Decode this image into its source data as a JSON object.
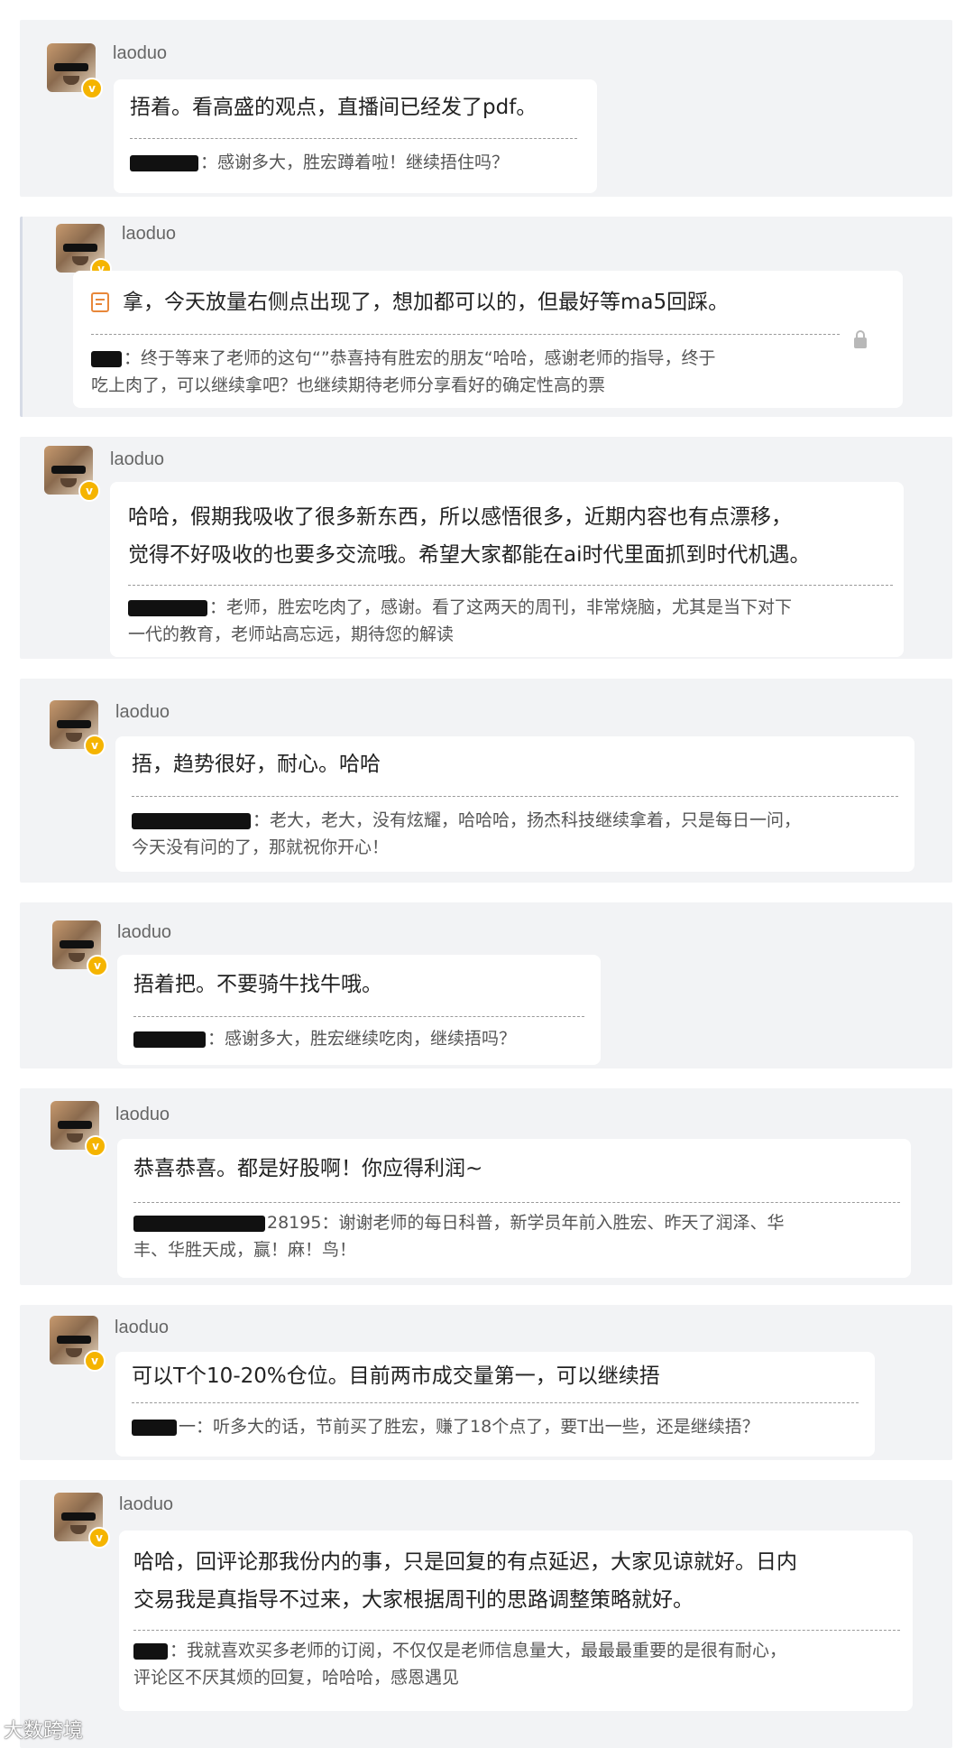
{
  "comments": [
    {
      "user": "laoduo",
      "message_lines": [
        "捂着。看高盛的观点，直播间已经发了pdf。"
      ],
      "reply_author_suffix": "",
      "reply_lines": [
        "：感谢多大，胜宏蹲着啦！继续捂住吗？"
      ]
    },
    {
      "user": "laoduo",
      "message_lines": [
        "拿，今天放量右侧点出现了，想加都可以的，但最好等ma5回踩。"
      ],
      "reply_author_suffix": "",
      "reply_lines": [
        "：终于等来了老师的这句“”恭喜持有胜宏的朋友“哈哈，感谢老师的指导，终于",
        "吃上肉了，可以继续拿吧？也继续期待老师分享看好的确定性高的票"
      ]
    },
    {
      "user": "laoduo",
      "message_lines": [
        "哈哈，假期我吸收了很多新东西，所以感悟很多，近期内容也有点漂移，",
        "觉得不好吸收的也要多交流哦。希望大家都能在ai时代里面抓到时代机遇。"
      ],
      "reply_author_suffix": "",
      "reply_lines": [
        "：老师，胜宏吃肉了，感谢。看了这两天的周刊，非常烧脑，尤其是当下对下",
        "一代的教育，老师站高忘远，期待您的解读"
      ]
    },
    {
      "user": "laoduo",
      "message_lines": [
        "捂，趋势很好，耐心。哈哈"
      ],
      "reply_author_suffix": "",
      "reply_lines": [
        "：老大，老大，没有炫耀，哈哈哈，扬杰科技继续拿着，只是每日一问，",
        "今天没有问的了，那就祝你开心！"
      ]
    },
    {
      "user": "laoduo",
      "message_lines": [
        "捂着把。不要骑牛找牛哦。"
      ],
      "reply_author_suffix": "",
      "reply_lines": [
        "：感谢多大，胜宏继续吃肉，继续捂吗？"
      ]
    },
    {
      "user": "laoduo",
      "message_lines": [
        "恭喜恭喜。都是好股啊！你应得利润~"
      ],
      "reply_author_suffix": "28195",
      "reply_lines": [
        "：谢谢老师的每日科普，新学员年前入胜宏、昨天了润泽、华",
        "丰、华胜天成，赢！麻！鸟！"
      ]
    },
    {
      "user": "laoduo",
      "message_lines": [
        "可以T个10-20%仓位。目前两市成交量第一，可以继续捂"
      ],
      "reply_author_suffix": "一",
      "reply_lines": [
        "：听多大的话，节前买了胜宏，赚了18个点了，要T出一些，还是继续捂？"
      ]
    },
    {
      "user": "laoduo",
      "message_lines": [
        "哈哈，回评论那我份内的事，只是回复的有点延迟，大家见谅就好。日内",
        "交易我是真指导不过来，大家根据周刊的思路调整策略就好。"
      ],
      "reply_author_suffix": "",
      "reply_lines": [
        "：我就喜欢买多老师的订阅，不仅仅是老师信息量大，最最最重要的是很有耐心，",
        "评论区不厌其烦的回复，哈哈哈，感恩遇见"
      ]
    }
  ],
  "watermark": "大数跨境",
  "colors": {
    "vip_badge": "#f5b400",
    "memo_icon": "#e8873a",
    "card_bg": "#f2f3f5"
  }
}
